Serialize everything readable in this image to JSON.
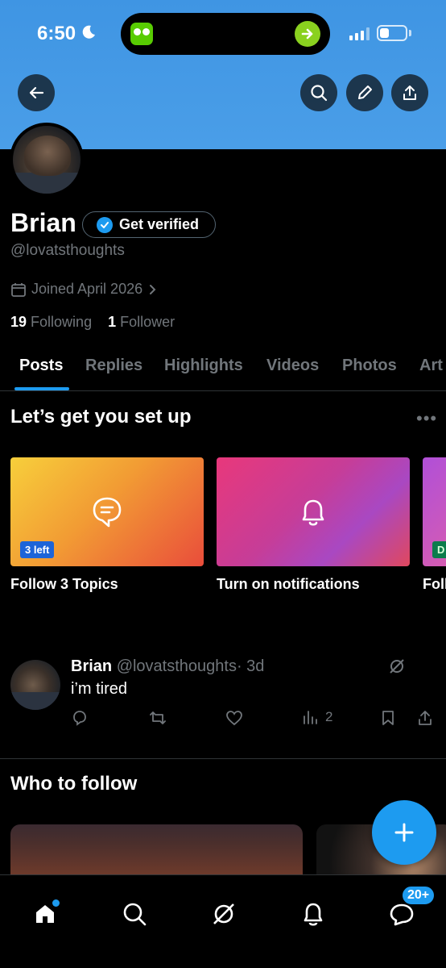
{
  "status_bar": {
    "time": "6:50",
    "battery_level": 0.35
  },
  "profile": {
    "name": "Brian",
    "verify_label": "Get verified",
    "handle": "@lovatsthoughts",
    "joined": "Joined April 2026",
    "following_count": "19",
    "following_label": "Following",
    "followers_count": "1",
    "followers_label": "Follower"
  },
  "tabs": [
    "Posts",
    "Replies",
    "Highlights",
    "Videos",
    "Photos",
    "Art"
  ],
  "setup": {
    "title": "Let’s get you set up",
    "cards": [
      {
        "label": "Follow 3 Topics",
        "badge": "3 left",
        "icon": "chat-bubble-icon"
      },
      {
        "label": "Turn on notifications",
        "icon": "bell-icon"
      },
      {
        "label": "Foll",
        "badge": "D"
      }
    ]
  },
  "tweet": {
    "name": "Brian",
    "handle": "@lovatsthoughts",
    "time": "· 3d",
    "text": "i’m tired",
    "views": "2"
  },
  "who_to_follow": {
    "title": "Who to follow"
  },
  "nav": {
    "messages_badge": "20+"
  },
  "colors": {
    "accent": "#1d9bf0",
    "banner": "#4a9ee8",
    "background": "#000000",
    "muted": "#71767b"
  }
}
